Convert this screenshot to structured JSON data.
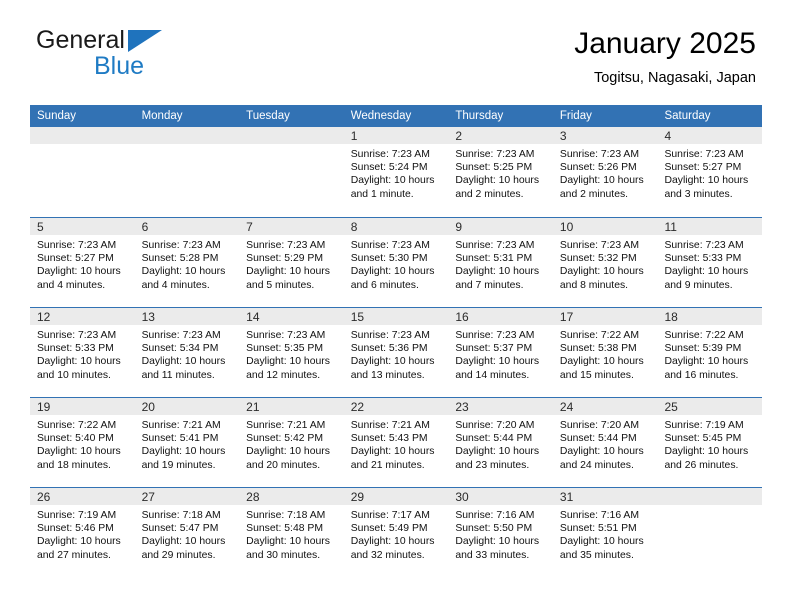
{
  "brand": {
    "name_top": "General",
    "name_bottom": "Blue",
    "triangle_color": "#1f73bd",
    "blue_color": "#1f7bc4"
  },
  "header": {
    "title": "January 2025",
    "subtitle": "Togitsu, Nagasaki, Japan"
  },
  "theme": {
    "header_blue": "#3272b4",
    "daynum_gray": "#ebebeb",
    "text": "#111111"
  },
  "weekdays": [
    "Sunday",
    "Monday",
    "Tuesday",
    "Wednesday",
    "Thursday",
    "Friday",
    "Saturday"
  ],
  "weeks": [
    [
      {
        "day": "",
        "empty": true
      },
      {
        "day": "",
        "empty": true
      },
      {
        "day": "",
        "empty": true
      },
      {
        "day": "1",
        "sunrise": "Sunrise: 7:23 AM",
        "sunset": "Sunset: 5:24 PM",
        "daylight1": "Daylight: 10 hours",
        "daylight2": "and 1 minute."
      },
      {
        "day": "2",
        "sunrise": "Sunrise: 7:23 AM",
        "sunset": "Sunset: 5:25 PM",
        "daylight1": "Daylight: 10 hours",
        "daylight2": "and 2 minutes."
      },
      {
        "day": "3",
        "sunrise": "Sunrise: 7:23 AM",
        "sunset": "Sunset: 5:26 PM",
        "daylight1": "Daylight: 10 hours",
        "daylight2": "and 2 minutes."
      },
      {
        "day": "4",
        "sunrise": "Sunrise: 7:23 AM",
        "sunset": "Sunset: 5:27 PM",
        "daylight1": "Daylight: 10 hours",
        "daylight2": "and 3 minutes."
      }
    ],
    [
      {
        "day": "5",
        "sunrise": "Sunrise: 7:23 AM",
        "sunset": "Sunset: 5:27 PM",
        "daylight1": "Daylight: 10 hours",
        "daylight2": "and 4 minutes."
      },
      {
        "day": "6",
        "sunrise": "Sunrise: 7:23 AM",
        "sunset": "Sunset: 5:28 PM",
        "daylight1": "Daylight: 10 hours",
        "daylight2": "and 4 minutes."
      },
      {
        "day": "7",
        "sunrise": "Sunrise: 7:23 AM",
        "sunset": "Sunset: 5:29 PM",
        "daylight1": "Daylight: 10 hours",
        "daylight2": "and 5 minutes."
      },
      {
        "day": "8",
        "sunrise": "Sunrise: 7:23 AM",
        "sunset": "Sunset: 5:30 PM",
        "daylight1": "Daylight: 10 hours",
        "daylight2": "and 6 minutes."
      },
      {
        "day": "9",
        "sunrise": "Sunrise: 7:23 AM",
        "sunset": "Sunset: 5:31 PM",
        "daylight1": "Daylight: 10 hours",
        "daylight2": "and 7 minutes."
      },
      {
        "day": "10",
        "sunrise": "Sunrise: 7:23 AM",
        "sunset": "Sunset: 5:32 PM",
        "daylight1": "Daylight: 10 hours",
        "daylight2": "and 8 minutes."
      },
      {
        "day": "11",
        "sunrise": "Sunrise: 7:23 AM",
        "sunset": "Sunset: 5:33 PM",
        "daylight1": "Daylight: 10 hours",
        "daylight2": "and 9 minutes."
      }
    ],
    [
      {
        "day": "12",
        "sunrise": "Sunrise: 7:23 AM",
        "sunset": "Sunset: 5:33 PM",
        "daylight1": "Daylight: 10 hours",
        "daylight2": "and 10 minutes."
      },
      {
        "day": "13",
        "sunrise": "Sunrise: 7:23 AM",
        "sunset": "Sunset: 5:34 PM",
        "daylight1": "Daylight: 10 hours",
        "daylight2": "and 11 minutes."
      },
      {
        "day": "14",
        "sunrise": "Sunrise: 7:23 AM",
        "sunset": "Sunset: 5:35 PM",
        "daylight1": "Daylight: 10 hours",
        "daylight2": "and 12 minutes."
      },
      {
        "day": "15",
        "sunrise": "Sunrise: 7:23 AM",
        "sunset": "Sunset: 5:36 PM",
        "daylight1": "Daylight: 10 hours",
        "daylight2": "and 13 minutes."
      },
      {
        "day": "16",
        "sunrise": "Sunrise: 7:23 AM",
        "sunset": "Sunset: 5:37 PM",
        "daylight1": "Daylight: 10 hours",
        "daylight2": "and 14 minutes."
      },
      {
        "day": "17",
        "sunrise": "Sunrise: 7:22 AM",
        "sunset": "Sunset: 5:38 PM",
        "daylight1": "Daylight: 10 hours",
        "daylight2": "and 15 minutes."
      },
      {
        "day": "18",
        "sunrise": "Sunrise: 7:22 AM",
        "sunset": "Sunset: 5:39 PM",
        "daylight1": "Daylight: 10 hours",
        "daylight2": "and 16 minutes."
      }
    ],
    [
      {
        "day": "19",
        "sunrise": "Sunrise: 7:22 AM",
        "sunset": "Sunset: 5:40 PM",
        "daylight1": "Daylight: 10 hours",
        "daylight2": "and 18 minutes."
      },
      {
        "day": "20",
        "sunrise": "Sunrise: 7:21 AM",
        "sunset": "Sunset: 5:41 PM",
        "daylight1": "Daylight: 10 hours",
        "daylight2": "and 19 minutes."
      },
      {
        "day": "21",
        "sunrise": "Sunrise: 7:21 AM",
        "sunset": "Sunset: 5:42 PM",
        "daylight1": "Daylight: 10 hours",
        "daylight2": "and 20 minutes."
      },
      {
        "day": "22",
        "sunrise": "Sunrise: 7:21 AM",
        "sunset": "Sunset: 5:43 PM",
        "daylight1": "Daylight: 10 hours",
        "daylight2": "and 21 minutes."
      },
      {
        "day": "23",
        "sunrise": "Sunrise: 7:20 AM",
        "sunset": "Sunset: 5:44 PM",
        "daylight1": "Daylight: 10 hours",
        "daylight2": "and 23 minutes."
      },
      {
        "day": "24",
        "sunrise": "Sunrise: 7:20 AM",
        "sunset": "Sunset: 5:44 PM",
        "daylight1": "Daylight: 10 hours",
        "daylight2": "and 24 minutes."
      },
      {
        "day": "25",
        "sunrise": "Sunrise: 7:19 AM",
        "sunset": "Sunset: 5:45 PM",
        "daylight1": "Daylight: 10 hours",
        "daylight2": "and 26 minutes."
      }
    ],
    [
      {
        "day": "26",
        "sunrise": "Sunrise: 7:19 AM",
        "sunset": "Sunset: 5:46 PM",
        "daylight1": "Daylight: 10 hours",
        "daylight2": "and 27 minutes."
      },
      {
        "day": "27",
        "sunrise": "Sunrise: 7:18 AM",
        "sunset": "Sunset: 5:47 PM",
        "daylight1": "Daylight: 10 hours",
        "daylight2": "and 29 minutes."
      },
      {
        "day": "28",
        "sunrise": "Sunrise: 7:18 AM",
        "sunset": "Sunset: 5:48 PM",
        "daylight1": "Daylight: 10 hours",
        "daylight2": "and 30 minutes."
      },
      {
        "day": "29",
        "sunrise": "Sunrise: 7:17 AM",
        "sunset": "Sunset: 5:49 PM",
        "daylight1": "Daylight: 10 hours",
        "daylight2": "and 32 minutes."
      },
      {
        "day": "30",
        "sunrise": "Sunrise: 7:16 AM",
        "sunset": "Sunset: 5:50 PM",
        "daylight1": "Daylight: 10 hours",
        "daylight2": "and 33 minutes."
      },
      {
        "day": "31",
        "sunrise": "Sunrise: 7:16 AM",
        "sunset": "Sunset: 5:51 PM",
        "daylight1": "Daylight: 10 hours",
        "daylight2": "and 35 minutes."
      },
      {
        "day": "",
        "empty": true
      }
    ]
  ]
}
